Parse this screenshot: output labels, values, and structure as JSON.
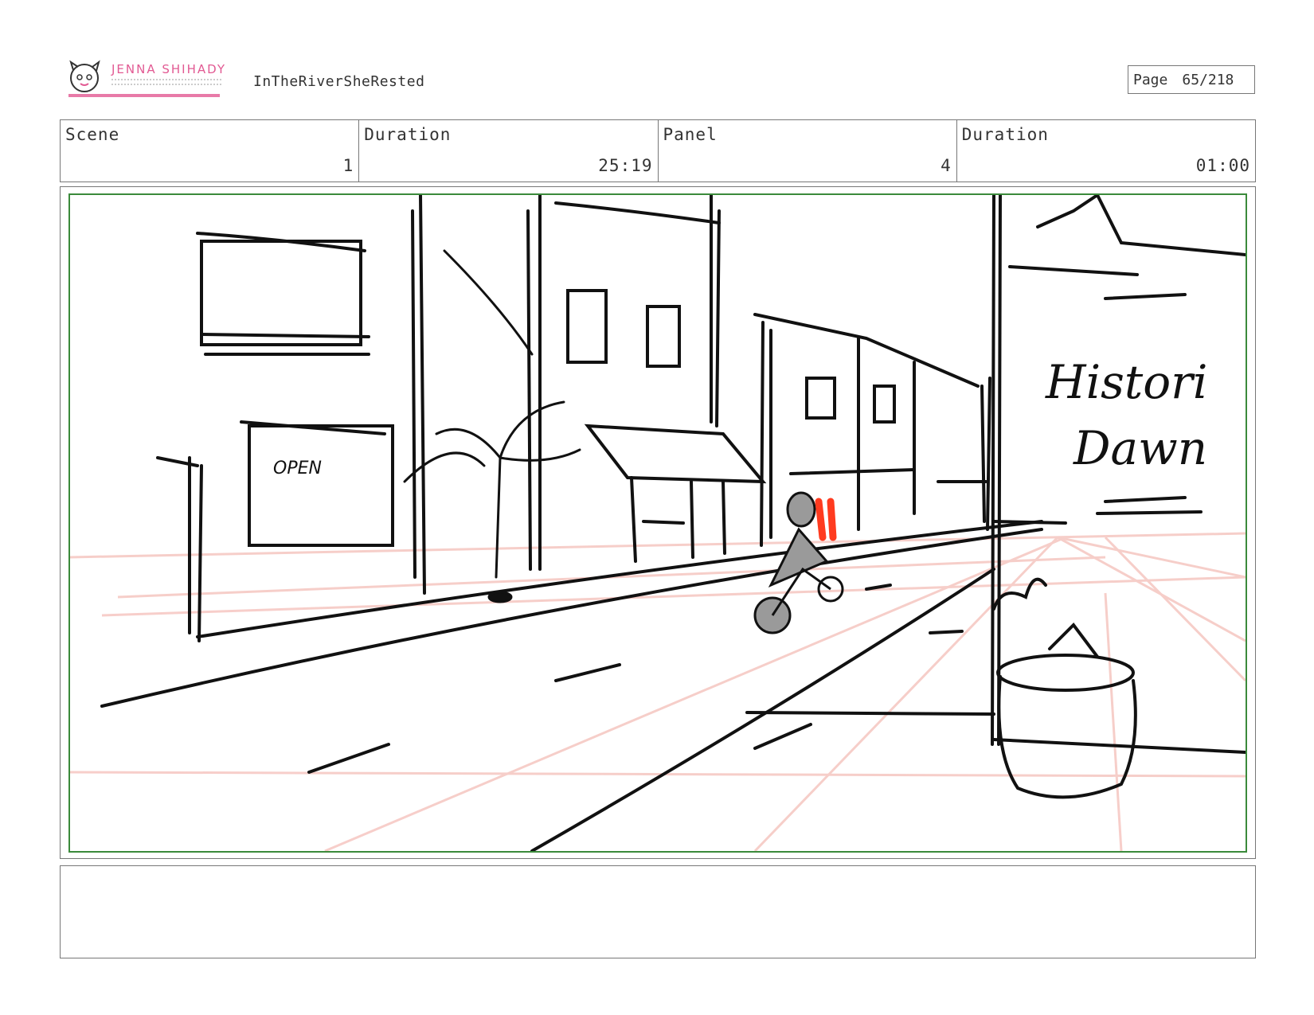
{
  "header": {
    "logo_name": "JENNA SHIHADY",
    "project_title": "InTheRiverSheRested",
    "page_label": "Page",
    "page_value": "65/218"
  },
  "info": {
    "scene_label": "Scene",
    "scene_value": "1",
    "scene_duration_label": "Duration",
    "scene_duration_value": "25:19",
    "panel_label": "Panel",
    "panel_value": "4",
    "panel_duration_label": "Duration",
    "panel_duration_value": "01:00"
  },
  "panel": {
    "sign_text_line1": "Histori",
    "sign_text_line2": "Dawn",
    "window_sign_text": "OPEN",
    "colors": {
      "frame": "#3b8a3b",
      "perspective_guides": "#f6c9c4",
      "cyclist_fill": "#9a9a9a",
      "cyclist_accent": "#ff3b1f"
    }
  },
  "notes": {
    "text": ""
  }
}
